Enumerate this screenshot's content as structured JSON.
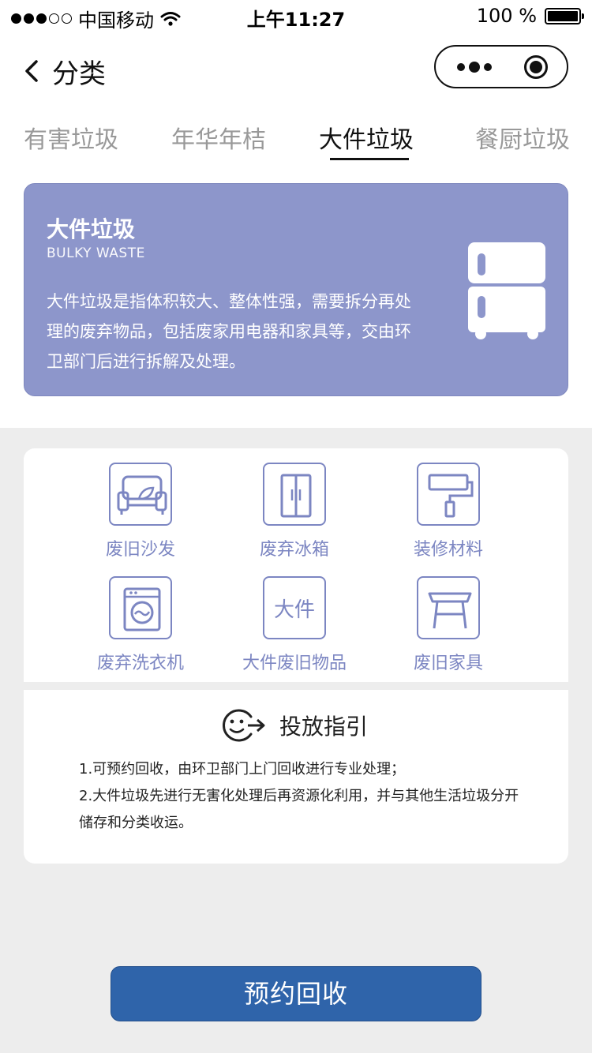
{
  "status_bar": {
    "carrier": "中国移动",
    "time": "上午11:27",
    "battery": "100 %",
    "battery_level": 1.0
  },
  "nav": {
    "title": "分类"
  },
  "tabs": [
    {
      "label": "有害垃圾",
      "active": false
    },
    {
      "label": "年华年桔",
      "active": false
    },
    {
      "label": "大件垃圾",
      "active": true
    },
    {
      "label": "餐厨垃圾",
      "active": false
    }
  ],
  "hero": {
    "title": "大件垃圾",
    "subtitle": "BULKY WASTE",
    "description": "大件垃圾是指体积较大、整体性强，需要拆分再处理的废弃物品，包括废家用电器和家具等，交由环卫部门后进行拆解及处理。",
    "icon": "refrigerator-icon",
    "background_color": "#8d96cb"
  },
  "categories": [
    {
      "label": "废旧沙发",
      "icon": "sofa-icon"
    },
    {
      "label": "废弃冰箱",
      "icon": "refrigerator-icon"
    },
    {
      "label": "装修材料",
      "icon": "paint-roller-icon"
    },
    {
      "label": "废弃洗衣机",
      "icon": "washing-machine-icon"
    },
    {
      "label": "大件废旧物品",
      "icon": "text-icon",
      "icon_text": "大件"
    },
    {
      "label": "废旧家具",
      "icon": "table-icon"
    }
  ],
  "guide": {
    "title": "投放指引",
    "icon": "smiley-arrow-icon",
    "lines": [
      "1.可预约回收，由环卫部门上门回收进行专业处理；",
      "2.大件垃圾先进行无害化处理后再资源化利用，并与其他生活垃圾分开储存和分类收运。"
    ]
  },
  "cta": {
    "label": "预约回收",
    "color": "#2f64aa"
  },
  "colors": {
    "accent": "#7c86c2",
    "page_bg": "#ededed"
  }
}
